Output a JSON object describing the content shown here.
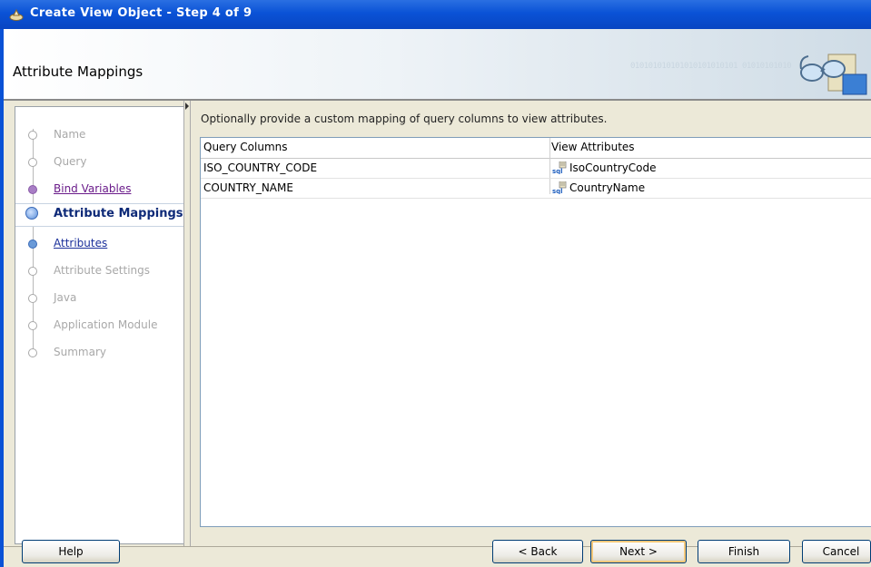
{
  "window": {
    "title": "Create View Object - Step 4 of 9"
  },
  "header": {
    "title": "Attribute Mappings",
    "decor_text": "010101010101010101010101 01010101010"
  },
  "nav": {
    "items": [
      {
        "label": "Name",
        "state": "disabled"
      },
      {
        "label": "Query",
        "state": "disabled"
      },
      {
        "label": "Bind Variables",
        "state": "visited"
      },
      {
        "label": "Attribute Mappings",
        "state": "current"
      },
      {
        "label": "Attributes",
        "state": "link"
      },
      {
        "label": "Attribute Settings",
        "state": "disabled"
      },
      {
        "label": "Java",
        "state": "disabled"
      },
      {
        "label": "Application Module",
        "state": "disabled"
      },
      {
        "label": "Summary",
        "state": "disabled"
      }
    ]
  },
  "main": {
    "instruction": "Optionally provide a custom mapping of query columns to view attributes.",
    "table": {
      "columns": [
        "Query Columns",
        "View Attributes"
      ],
      "rows": [
        [
          "ISO_COUNTRY_CODE",
          "IsoCountryCode"
        ],
        [
          "COUNTRY_NAME",
          "CountryName"
        ]
      ]
    }
  },
  "buttons": {
    "help": "Help",
    "back": "< Back",
    "next": "Next >",
    "finish": "Finish",
    "cancel": "Cancel"
  },
  "colors": {
    "title_bar": "#0a52d6",
    "current_step": "#0e2a78",
    "visited_step": "#6a1b8a"
  },
  "icons": {
    "title": "wizard-icon",
    "header": "view-object-glasses-icon",
    "attribute": "sql-attribute-icon"
  }
}
